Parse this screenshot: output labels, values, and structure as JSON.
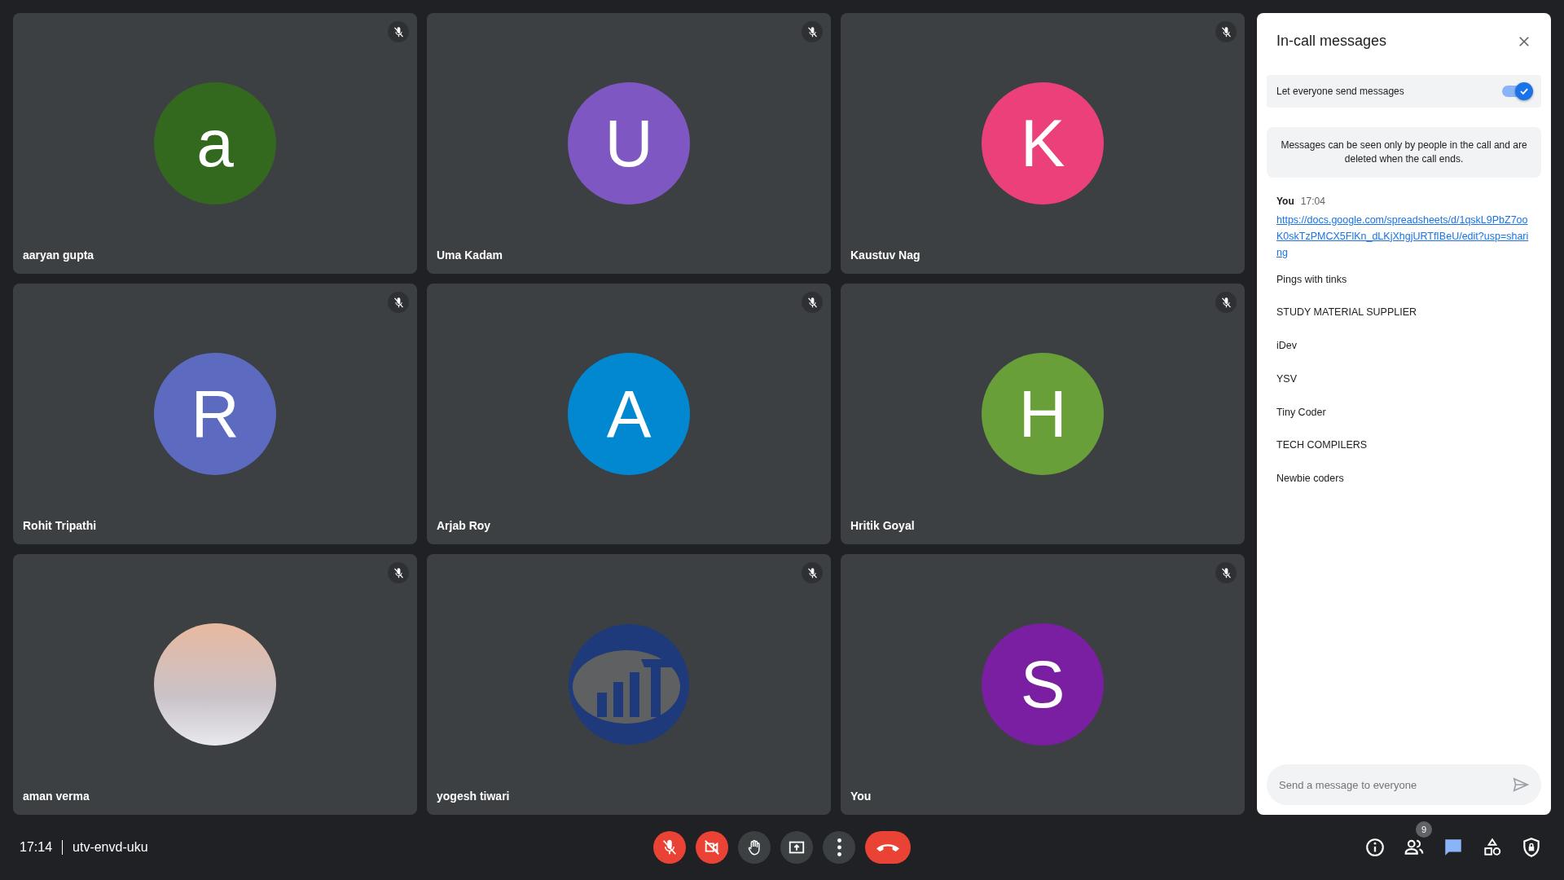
{
  "tiles": [
    {
      "name": "aaryan gupta",
      "kind": "letter",
      "initial": "a",
      "color": "#33691e",
      "muted": true
    },
    {
      "name": "Uma Kadam",
      "kind": "letter",
      "initial": "U",
      "color": "#7e57c2",
      "muted": true
    },
    {
      "name": "Kaustuv Nag",
      "kind": "letter",
      "initial": "K",
      "color": "#ec407a",
      "muted": true
    },
    {
      "name": "Rohit Tripathi",
      "kind": "letter",
      "initial": "R",
      "color": "#5c6bc0",
      "muted": true
    },
    {
      "name": "Arjab Roy",
      "kind": "letter",
      "initial": "A",
      "color": "#0288d1",
      "muted": true
    },
    {
      "name": "Hritik Goyal",
      "kind": "letter",
      "initial": "H",
      "color": "#689f38",
      "muted": true
    },
    {
      "name": "aman verma",
      "kind": "photo",
      "muted": true
    },
    {
      "name": "yogesh tiwari",
      "kind": "logo",
      "muted": true
    },
    {
      "name": "You",
      "kind": "letter",
      "initial": "S",
      "color": "#7b1fa2",
      "muted": true
    }
  ],
  "chat": {
    "title": "In-call messages",
    "toggle": {
      "label": "Let everyone send messages",
      "on": true
    },
    "notice": "Messages can be seen only by people in the call and are deleted when the call ends.",
    "group": {
      "sender": "You",
      "time": "17:04",
      "messages": [
        {
          "kind": "link",
          "text": "https://docs.google.com/spreadsheets/d/1qskL9PbZ7ooK0skTzPMCX5FlKn_dLKjXhgjURTfIBeU/edit?usp=sharing"
        },
        {
          "kind": "text",
          "text": "Pings with tinks"
        },
        {
          "kind": "text",
          "text": "STUDY MATERIAL SUPPLIER"
        },
        {
          "kind": "text",
          "text": "iDev"
        },
        {
          "kind": "text",
          "text": "YSV"
        },
        {
          "kind": "text",
          "text": "Tiny Coder"
        },
        {
          "kind": "text",
          "text": "TECH COMPILERS"
        },
        {
          "kind": "text",
          "text": "Newbie coders"
        }
      ]
    },
    "composer": {
      "placeholder": "Send a message to everyone"
    }
  },
  "bottom_bar": {
    "time": "17:14",
    "meeting_code": "utv-envd-uku",
    "controls": [
      {
        "kind": "mic",
        "on": false
      },
      {
        "kind": "camera",
        "on": false
      },
      {
        "kind": "hand"
      },
      {
        "kind": "present"
      },
      {
        "kind": "more"
      },
      {
        "kind": "end"
      }
    ],
    "side": [
      {
        "kind": "info",
        "selected": false
      },
      {
        "kind": "people",
        "badge": "9",
        "selected": false
      },
      {
        "kind": "chat",
        "selected": true
      },
      {
        "kind": "activities",
        "selected": false
      },
      {
        "kind": "safety",
        "selected": false
      }
    ]
  }
}
